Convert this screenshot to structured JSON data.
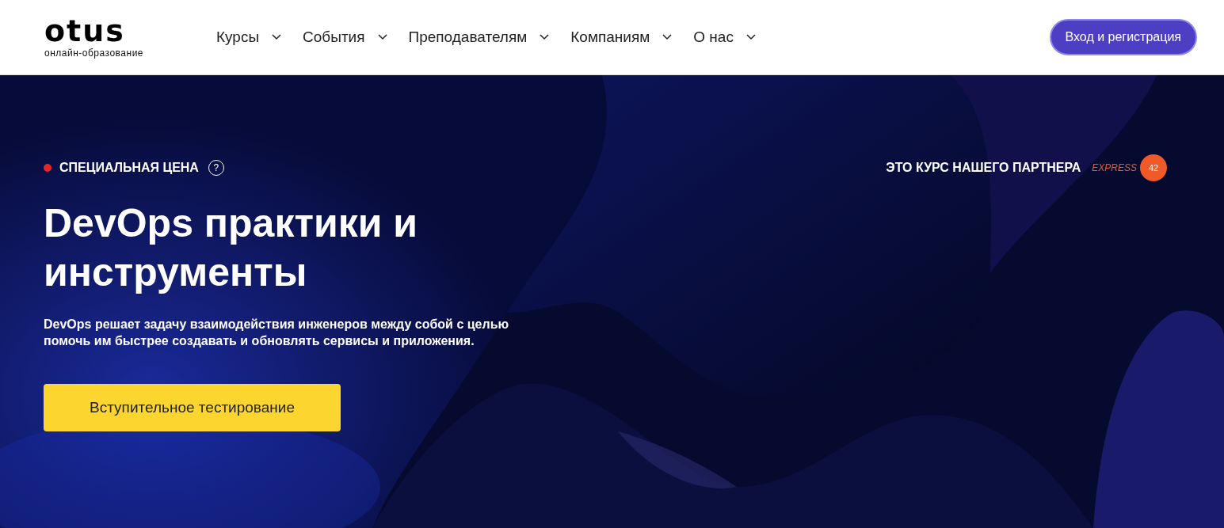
{
  "header": {
    "logo": {
      "mark": "otus",
      "tagline": "онлайн-образование"
    },
    "nav": [
      {
        "label": "Курсы",
        "dropdown": true
      },
      {
        "label": "События",
        "dropdown": true
      },
      {
        "label": "Преподавателям",
        "dropdown": true
      },
      {
        "label": "Компаниям",
        "dropdown": true
      },
      {
        "label": "О нас",
        "dropdown": true
      }
    ],
    "login_button": "Вход и регистрация"
  },
  "hero": {
    "kind": "picture",
    "badge": {
      "label": "СПЕЦИАЛЬНАЯ ЦЕНА",
      "color": "#e32626",
      "help": "?"
    },
    "partner": {
      "label": "ЭТО КУРС НАШЕГО ПАРТНЕРА",
      "logo_word": "EXPRESS",
      "logo_number": "42"
    },
    "title": "DevOps практики и инструменты",
    "description": "DevOps решает задачу взаимодействия инженеров между собой с целью помочь им быстрее создавать и обновлять сервисы и приложения.",
    "cta_button": "Вступительное тестирование"
  }
}
